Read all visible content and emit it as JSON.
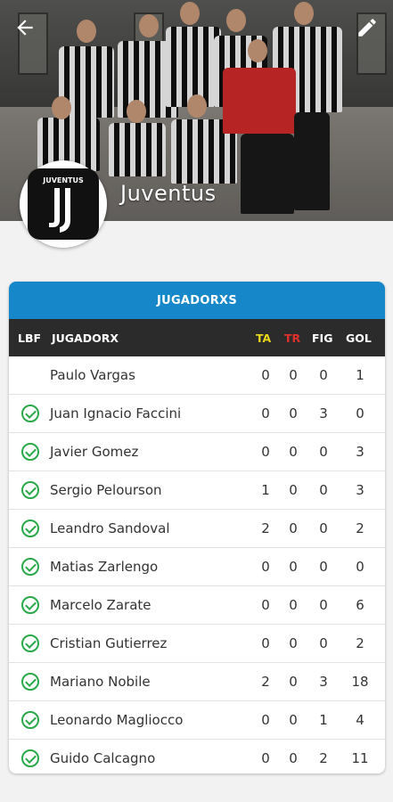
{
  "header": {
    "team_name": "Juventus",
    "logo_text": "JUVENTUS"
  },
  "table": {
    "title": "JUGADORXS",
    "columns": {
      "lbf": "LBF",
      "player": "JUGADORX",
      "ta": "TA",
      "tr": "TR",
      "fig": "FIG",
      "gol": "GOL"
    },
    "colors": {
      "header_bg": "#1687c8",
      "ta": "#e8d51a",
      "tr": "#e0302b",
      "check": "#2aa84a"
    },
    "rows": [
      {
        "name": "Paulo Vargas",
        "lbf": false,
        "ta": "0",
        "tr": "0",
        "fig": "0",
        "gol": "1"
      },
      {
        "name": "Juan Ignacio Faccini",
        "lbf": true,
        "ta": "0",
        "tr": "0",
        "fig": "3",
        "gol": "0"
      },
      {
        "name": "Javier Gomez",
        "lbf": true,
        "ta": "0",
        "tr": "0",
        "fig": "0",
        "gol": "3"
      },
      {
        "name": "Sergio Pelourson",
        "lbf": true,
        "ta": "1",
        "tr": "0",
        "fig": "0",
        "gol": "3"
      },
      {
        "name": "Leandro Sandoval",
        "lbf": true,
        "ta": "2",
        "tr": "0",
        "fig": "0",
        "gol": "2"
      },
      {
        "name": "Matias Zarlengo",
        "lbf": true,
        "ta": "0",
        "tr": "0",
        "fig": "0",
        "gol": "0"
      },
      {
        "name": "Marcelo Zarate",
        "lbf": true,
        "ta": "0",
        "tr": "0",
        "fig": "0",
        "gol": "6"
      },
      {
        "name": "Cristian Gutierrez",
        "lbf": true,
        "ta": "0",
        "tr": "0",
        "fig": "0",
        "gol": "2"
      },
      {
        "name": "Mariano Nobile",
        "lbf": true,
        "ta": "2",
        "tr": "0",
        "fig": "3",
        "gol": "18"
      },
      {
        "name": "Leonardo Magliocco",
        "lbf": true,
        "ta": "0",
        "tr": "0",
        "fig": "1",
        "gol": "4"
      },
      {
        "name": "Guido Calcagno",
        "lbf": true,
        "ta": "0",
        "tr": "0",
        "fig": "2",
        "gol": "11"
      }
    ]
  }
}
